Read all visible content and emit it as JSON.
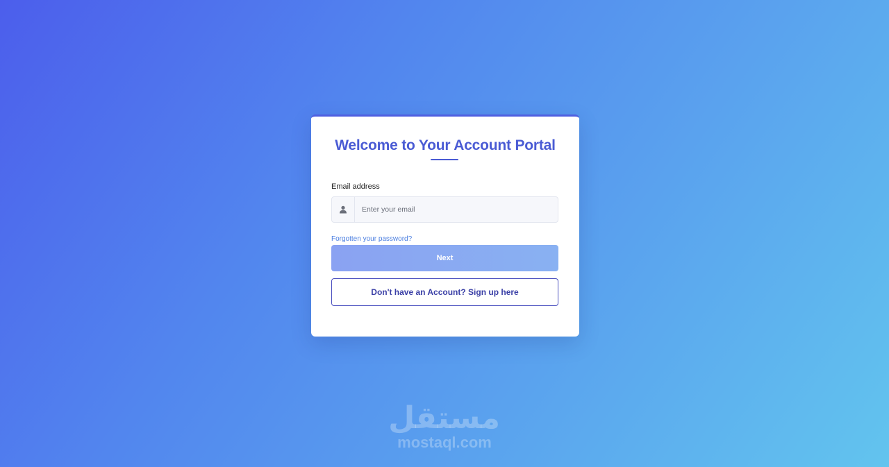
{
  "login": {
    "title": "Welcome to Your Account Portal",
    "email_label": "Email address",
    "email_placeholder": "Enter your email",
    "email_value": "",
    "forgot_link": "Forgotten your password?",
    "next_label": "Next",
    "signup_label": "Don't have an Account? Sign up here"
  },
  "watermark": {
    "arabic": "مستقل",
    "latin": "mostaql.com"
  },
  "icons": {
    "email_field": "user-icon"
  },
  "colors": {
    "accent": "#4a5bd4",
    "link": "#4a7ee0",
    "next_button": "#8aa2f2",
    "signup_border": "#4a4fbf",
    "background_start": "#4c5eec",
    "background_end": "#62c4ee"
  }
}
